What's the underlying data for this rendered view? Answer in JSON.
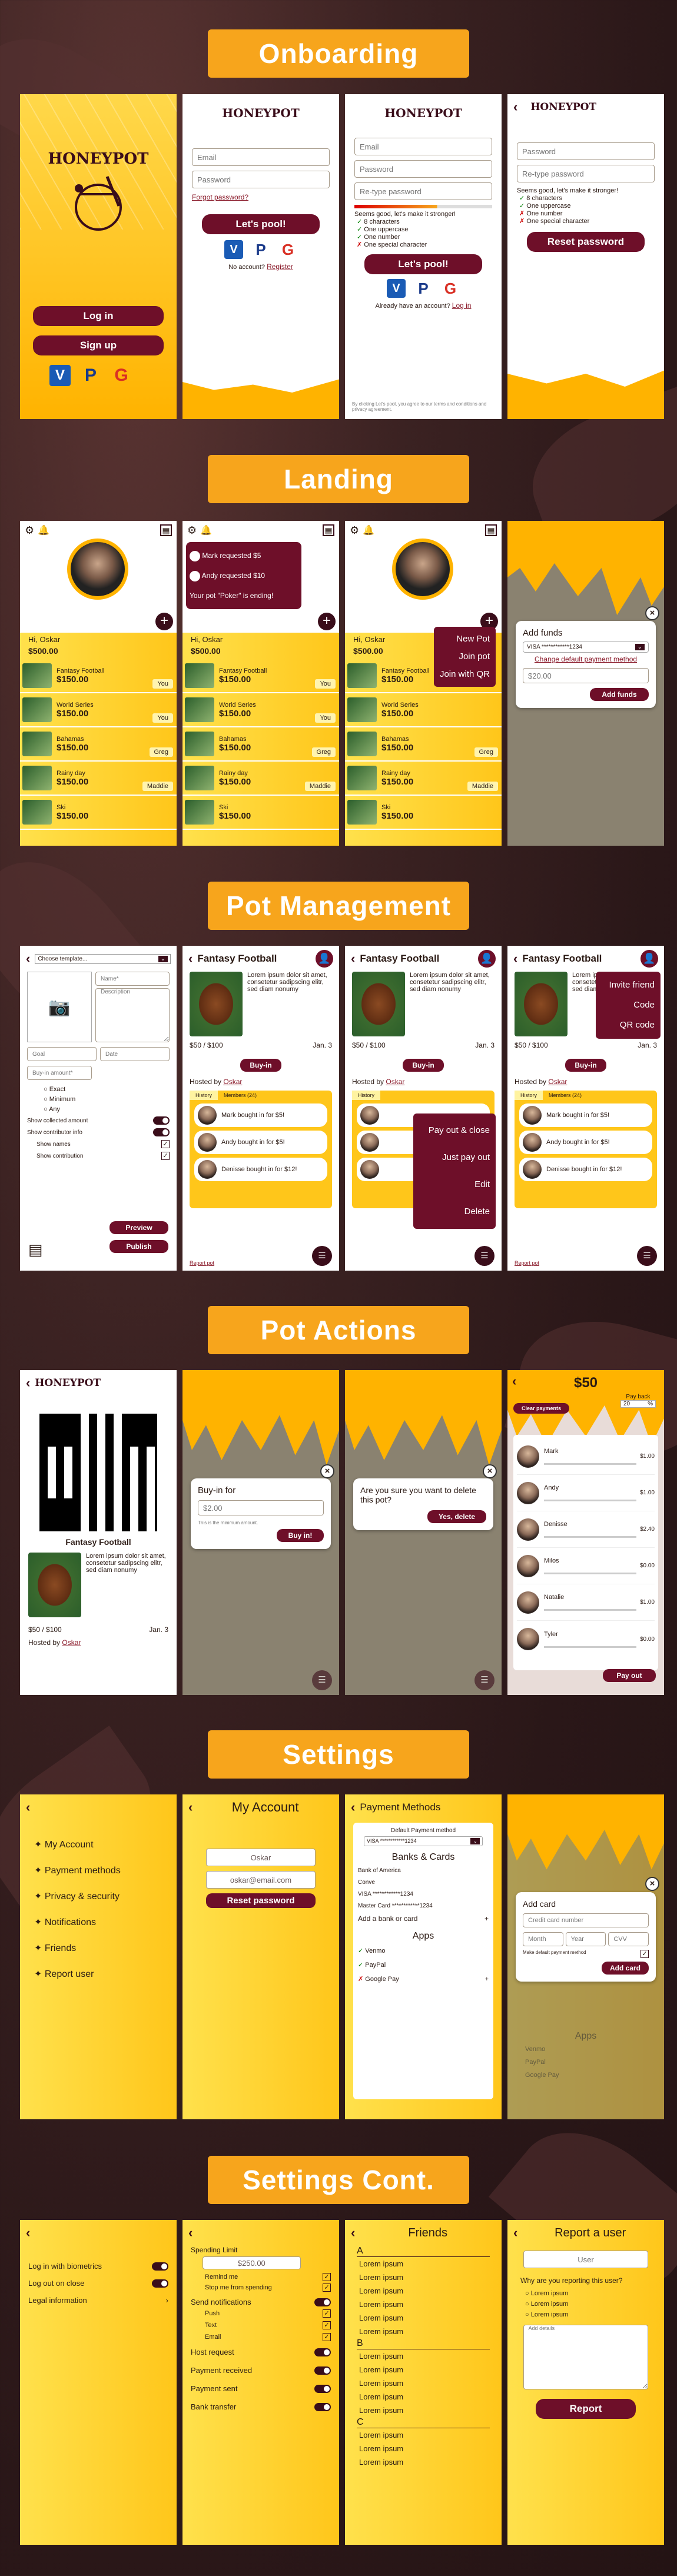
{
  "sections": [
    "Onboarding",
    "Landing",
    "Pot Management",
    "Pot Actions",
    "Settings",
    "Settings Cont."
  ],
  "app": {
    "name": "HONEYPOT"
  },
  "onboarding": {
    "login": "Log in",
    "signup": "Sign up",
    "email_ph": "Email",
    "password_ph": "Password",
    "retype_ph": "Re-type password",
    "forgot": "Forgot password?",
    "letspool": "Let's pool!",
    "no_account": "No account?",
    "register": "Register",
    "have_account": "Already have an account?",
    "login_link": "Log in",
    "pw_msg": "Seems good, let's make it stronger!",
    "rules": [
      "8 characters",
      "One uppercase",
      "One number",
      "One special character"
    ],
    "reset": "Reset password",
    "terms": "By clicking Let's pool, you agree to our terms and conditions and privacy agreement."
  },
  "landing": {
    "greeting": "Hi, Oskar",
    "balance": "$500.00",
    "notif1": "Mark requested $5",
    "notif2": "Andy requested $10",
    "notif3": "Your pot \"Poker\" is ending!",
    "pots": [
      {
        "name": "Fantasy Football",
        "amount": "$150.00",
        "who": "You"
      },
      {
        "name": "World Series",
        "amount": "$150.00",
        "who": "You"
      },
      {
        "name": "Bahamas",
        "amount": "$150.00",
        "who": "Greg"
      },
      {
        "name": "Rainy day",
        "amount": "$150.00",
        "who": "Maddie"
      },
      {
        "name": "Ski",
        "amount": "$150.00",
        "who": ""
      }
    ],
    "plus_menu": [
      "New Pot",
      "Join pot",
      "Join with QR"
    ],
    "add_funds": "Add funds",
    "card": "VISA ************1234",
    "change_default": "Change default payment method",
    "amount_ph": "$20.00"
  },
  "potmgmt": {
    "choose_template": "Choose template...",
    "name_ph": "Name*",
    "desc_ph": "Description",
    "goal_ph": "Goal",
    "date_ph": "Date",
    "buyin_ph": "Buy-in amount*",
    "radios": [
      "Exact",
      "Minimum",
      "Any"
    ],
    "options": [
      "Show collected amount",
      "Show contributor info",
      "Show names",
      "Show contribution"
    ],
    "preview": "Preview",
    "publish": "Publish",
    "title": "Fantasy Football",
    "lorem": "Lorem ipsum dolor sit amet, consetetur sadipscing elitr, sed diam nonumy",
    "progress": "$50 / $100",
    "date": "Jan. 3",
    "buyin": "Buy-in",
    "hosted": "Hosted by",
    "host": "Oskar",
    "tabs": [
      "History",
      "Members (24)"
    ],
    "history": [
      "Mark bought in for $5!",
      "Andy bought in for $5!",
      "Denisse bought in for $12!"
    ],
    "report": "Report pot",
    "host_menu": [
      "Pay out & close",
      "Just pay out",
      "Edit",
      "Delete"
    ],
    "invite_menu": [
      "Invite friend",
      "Code",
      "QR code"
    ]
  },
  "potactions": {
    "buyin_for": "Buy-in for",
    "buyin_amt": "$2.00",
    "buyin_note": "This is the minimum amount.",
    "buyin_btn": "Buy in!",
    "delete_q": "Are you sure you want to delete this pot?",
    "delete_btn": "Yes, delete",
    "total": "$50",
    "payback": "Pay back",
    "clear": "Clear payments",
    "pct": "20",
    "members": [
      {
        "name": "Mark",
        "amt": "$1.00"
      },
      {
        "name": "Andy",
        "amt": "$1.00"
      },
      {
        "name": "Denisse",
        "amt": "$2.40"
      },
      {
        "name": "Milos",
        "amt": "$0.00"
      },
      {
        "name": "Natalie",
        "amt": "$1.00"
      },
      {
        "name": "Tyler",
        "amt": "$0.00"
      }
    ],
    "payout": "Pay out"
  },
  "settings": {
    "menu": [
      "My Account",
      "Payment methods",
      "Privacy & security",
      "Notifications",
      "Friends",
      "Report user"
    ],
    "account_title": "My Account",
    "name": "Oskar",
    "email": "oskar@email.com",
    "reset": "Reset password",
    "pm_title": "Payment Methods",
    "default_pm": "Default Payment method",
    "card": "VISA ************1234",
    "banks_title": "Banks & Cards",
    "banks": [
      "Bank of America",
      "Conve",
      "VISA ************1234",
      "Master Card ************1234"
    ],
    "add_bank": "Add a bank or card",
    "apps_title": "Apps",
    "apps": [
      "Venmo",
      "PayPal",
      "Google Pay"
    ],
    "add_card": "Add card",
    "card_number_ph": "Credit card number",
    "month_ph": "Month",
    "year_ph": "Year",
    "cvv_ph": "CVV",
    "make_default": "Make default payment method"
  },
  "settings2": {
    "privacy": [
      "Log in with biometrics",
      "Log out on close",
      "Legal information"
    ],
    "spending_limit": "Spending Limit",
    "limit_value": "$250.00",
    "remind": "Remind me",
    "stop": "Stop me from spending",
    "send_notif": "Send notifications",
    "channels": [
      "Push",
      "Text",
      "Email"
    ],
    "events": [
      "Host request",
      "Payment received",
      "Payment sent",
      "Bank transfer"
    ],
    "friends_title": "Friends",
    "letters": [
      "A",
      "B",
      "C"
    ],
    "friend": "Lorem ipsum",
    "report_title": "Report a user",
    "user_ph": "User",
    "why": "Why are you reporting this user?",
    "reasons": [
      "Lorem ipsum",
      "Lorem ipsum",
      "Lorem ipsum"
    ],
    "add_details": "Add details",
    "report_btn": "Report"
  },
  "colors": {
    "accent": "#f7a51c",
    "brand": "#6e0f29",
    "honey": "#ffc61a"
  }
}
